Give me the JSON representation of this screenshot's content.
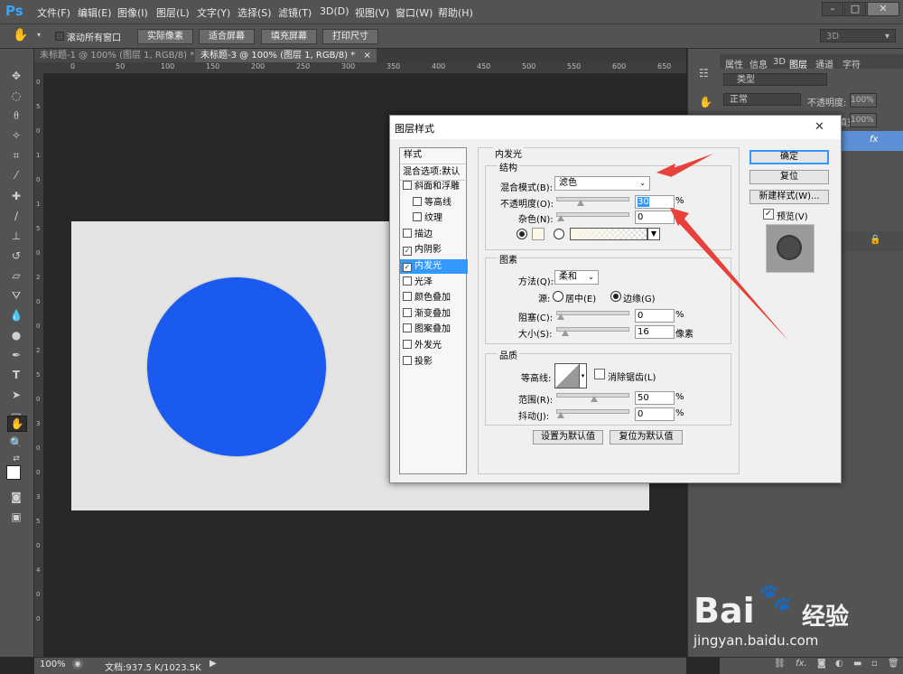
{
  "app": {
    "logo": "Ps"
  },
  "menu": [
    "文件(F)",
    "编辑(E)",
    "图像(I)",
    "图层(L)",
    "文字(Y)",
    "选择(S)",
    "滤镜(T)",
    "3D(D)",
    "视图(V)",
    "窗口(W)",
    "帮助(H)"
  ],
  "window_controls": {
    "minimize": "–",
    "maximize": "□",
    "close": "✕"
  },
  "options": {
    "scroll_all": "滚动所有窗口",
    "actual_pixels": "实际像素",
    "fit_screen": "适合屏幕",
    "fill_screen": "填充屏幕",
    "print_size": "打印尺寸",
    "workspace": "3D"
  },
  "tabs": [
    {
      "label": "未标题-1 @ 100% (图层 1, RGB/8) *",
      "close": "×"
    },
    {
      "label": "未标题-3 @ 100% (图层 1, RGB/8) *",
      "close": "×"
    }
  ],
  "ruler_ticks": [
    "0",
    "50",
    "100",
    "150",
    "200",
    "250",
    "300",
    "350",
    "400",
    "450",
    "500",
    "550",
    "600",
    "650"
  ],
  "vruler_ticks": [
    "0",
    "5",
    "0",
    "1",
    "0",
    "1",
    "5",
    "0",
    "2",
    "0",
    "0",
    "2",
    "5",
    "0",
    "3",
    "0",
    "0",
    "3",
    "5",
    "0",
    "4",
    "0",
    "0"
  ],
  "status": {
    "zoom": "100%",
    "doc": "文档:937.5 K/1023.5K"
  },
  "panel": {
    "tabs": [
      "属性",
      "信息",
      "3D",
      "图层",
      "通道",
      "字符"
    ],
    "kind": "类型",
    "blend": "正常",
    "opacity_label": "不透明度:",
    "opacity_value": "100%",
    "fill_label": "填充:",
    "fill_value": "100%",
    "fx": "fx"
  },
  "dialog": {
    "title": "图层样式",
    "close": "✕",
    "sidebar": {
      "styles": "样式",
      "blend_options": "混合选项:默认",
      "items": [
        {
          "label": "斜面和浮雕",
          "checked": false,
          "indent": false
        },
        {
          "label": "等高线",
          "checked": false,
          "indent": true
        },
        {
          "label": "纹理",
          "checked": false,
          "indent": true
        },
        {
          "label": "描边",
          "checked": false,
          "indent": false
        },
        {
          "label": "内阴影",
          "checked": true,
          "indent": false
        },
        {
          "label": "内发光",
          "checked": true,
          "indent": false,
          "selected": true
        },
        {
          "label": "光泽",
          "checked": false,
          "indent": false
        },
        {
          "label": "颜色叠加",
          "checked": false,
          "indent": false
        },
        {
          "label": "渐变叠加",
          "checked": false,
          "indent": false
        },
        {
          "label": "图案叠加",
          "checked": false,
          "indent": false
        },
        {
          "label": "外发光",
          "checked": false,
          "indent": false
        },
        {
          "label": "投影",
          "checked": false,
          "indent": false
        }
      ]
    },
    "inner_glow": "内发光",
    "structure": {
      "title": "结构",
      "blend_mode_label": "混合模式(B):",
      "blend_mode": "滤色",
      "opacity_label": "不透明度(O):",
      "opacity": "30",
      "opacity_fraction": 0.3,
      "noise_label": "杂色(N):",
      "noise": "0",
      "noise_fraction": 0.0,
      "percent": "%"
    },
    "elements": {
      "title": "图素",
      "method_label": "方法(Q):",
      "method": "柔和",
      "source_label": "源:",
      "center": "居中(E)",
      "edge": "边缘(G)",
      "choke_label": "阻塞(C):",
      "choke": "0",
      "choke_fraction": 0.0,
      "size_label": "大小(S):",
      "size": "16",
      "size_fraction": 0.065,
      "size_unit": "像素",
      "percent": "%"
    },
    "quality": {
      "title": "品质",
      "contour_label": "等高线:",
      "antialias": "消除锯齿(L)",
      "range_label": "范围(R):",
      "range": "50",
      "range_fraction": 0.5,
      "jitter_label": "抖动(J):",
      "jitter": "0",
      "jitter_fraction": 0.0,
      "percent": "%"
    },
    "set_default": "设置为默认值",
    "reset_default": "复位为默认值",
    "ok": "确定",
    "reset": "复位",
    "new_style": "新建样式(W)...",
    "preview": "预览(V)"
  },
  "watermark": {
    "brand": "Bai",
    "brand2": "经验",
    "url": "jingyan.baidu.com"
  },
  "colors": {
    "accent_arrow": "#e8403a",
    "selection": "#3399ff",
    "circle": "#1a5af0"
  }
}
